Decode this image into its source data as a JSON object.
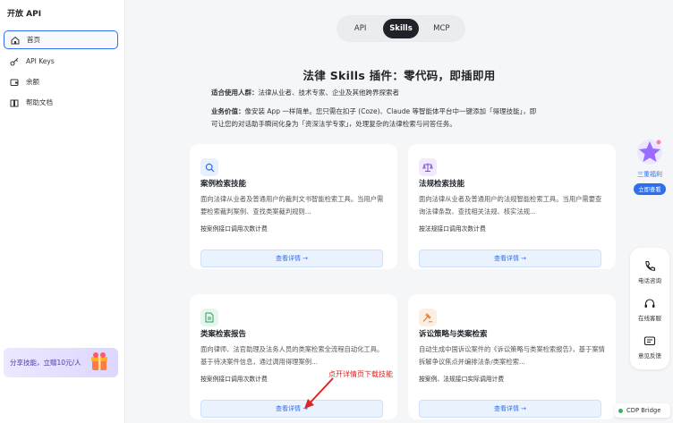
{
  "sidebar": {
    "brand": "开放 API",
    "items": [
      {
        "label": "首页",
        "icon": "home-icon",
        "active": true
      },
      {
        "label": "API Keys",
        "icon": "key-icon",
        "active": false
      },
      {
        "label": "余额",
        "icon": "wallet-icon",
        "active": false
      },
      {
        "label": "帮助文档",
        "icon": "book-icon",
        "active": false
      }
    ],
    "share_banner": "分享技能，立赠10元/人"
  },
  "tabs": [
    {
      "label": "API",
      "active": false
    },
    {
      "label": "Skills",
      "active": true
    },
    {
      "label": "MCP",
      "active": false
    }
  ],
  "headline": "法律 Skills 插件：零代码，即插即用",
  "audience": {
    "label": "适合使用人群：",
    "text": "法律从业者、技术专家、企业及其他跨界探索者"
  },
  "value": {
    "label": "业务价值：",
    "line1": "像安装 App 一样简单。您只需在扣子 (Coze)、Claude 等智能体平台中一键添加「得理技能」，即",
    "line2": "可让您的对话助手瞬间化身为「资深法学专家」，处理复杂的法律检索与问答任务。"
  },
  "cards": [
    {
      "title": "案例检索技能",
      "desc": "面向法律从业者及普通用户的裁判文书智能检索工具。当用户需要检索裁判案例、查找类案裁判规则...",
      "billing": "按案例接口调用次数计费",
      "button": "查看详情 →",
      "icon": "search-icon",
      "icon_color": "#2f6fed",
      "icon_bg": "#e8f0fe"
    },
    {
      "title": "法规检索技能",
      "desc": "面向法律从业者及普通用户的法规智能检索工具。当用户需要查询法律条款、查找相关法规、核实法规...",
      "billing": "按法规接口调用次数计费",
      "button": "查看详情 →",
      "icon": "scale-icon",
      "icon_color": "#7b4dd6",
      "icon_bg": "#f0eafc"
    },
    {
      "title": "类案检索报告",
      "desc": "面向律师、法官助理及法务人员的类案检索全流程自动化工具。基于待决案件信息，通过调用得理案例...",
      "billing": "按案例接口调用次数计费",
      "button": "查看详情 →",
      "icon": "document-icon",
      "icon_color": "#2a9d5c",
      "icon_bg": "#e6f6ec"
    },
    {
      "title": "诉讼策略与类案检索",
      "desc": "自动生成中国诉讼案件的《诉讼策略与类案检索报告》，基于案情拆解争议焦点并编排法条/类案检索...",
      "billing": "按案例、法规接口实际调用计费",
      "button": "查看详情 →",
      "icon": "gavel-icon",
      "icon_color": "#e07a2e",
      "icon_bg": "#fdeee2"
    }
  ],
  "annotation": "点开详情页下载技能",
  "promo": {
    "title": "三重福利",
    "button": "立即查看"
  },
  "support": [
    {
      "label": "电话咨询",
      "icon": "phone-icon"
    },
    {
      "label": "在线客服",
      "icon": "headset-icon"
    },
    {
      "label": "意见反馈",
      "icon": "feedback-icon"
    }
  ],
  "bridge": "CDP Bridge",
  "colors": {
    "accent": "#2f6fed",
    "annotation": "#e02424",
    "status": "#2db55d"
  }
}
